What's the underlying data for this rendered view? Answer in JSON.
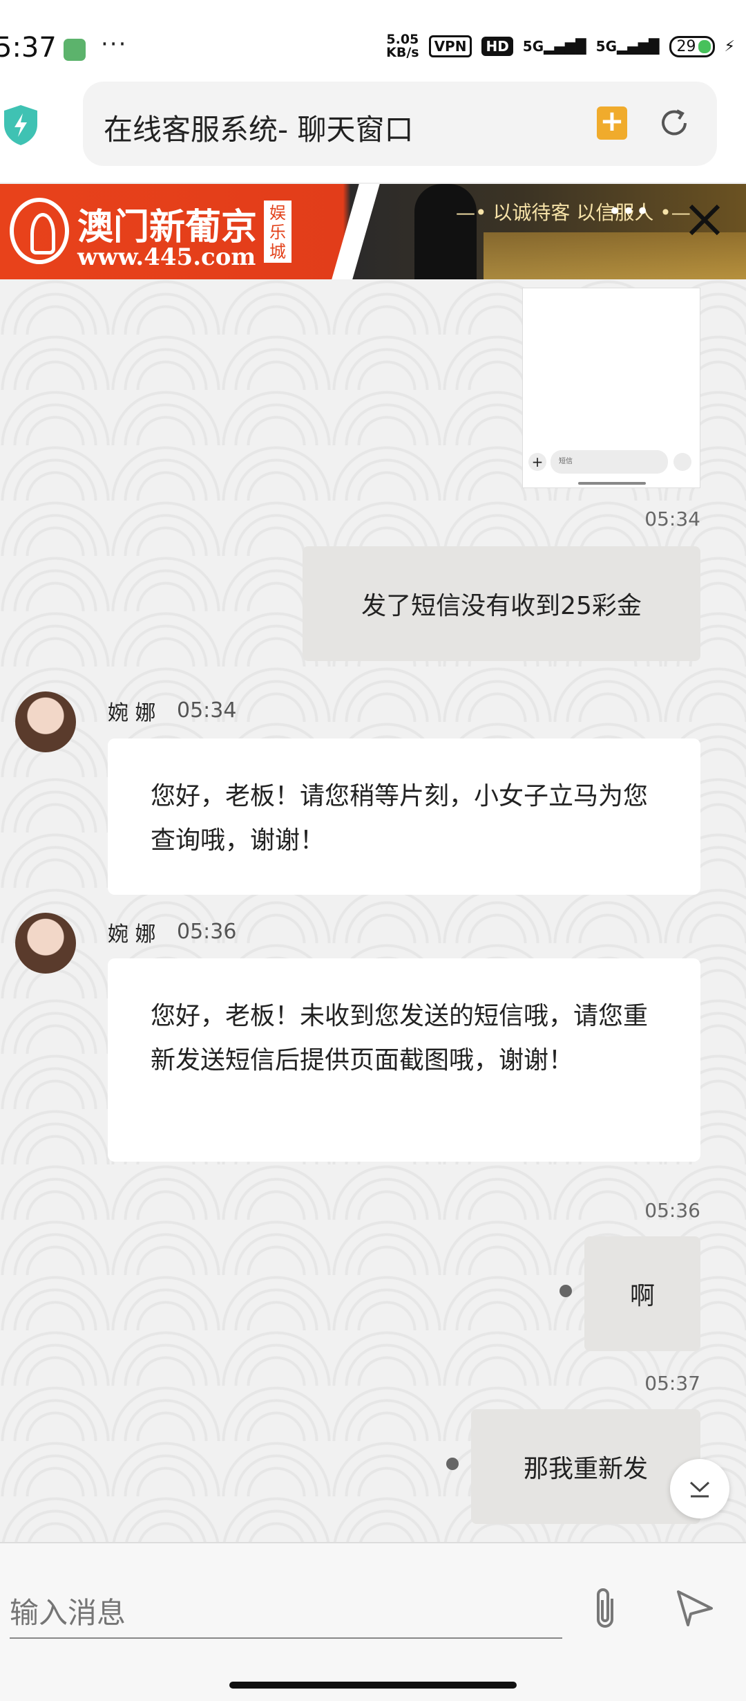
{
  "status_bar": {
    "time": "5:37",
    "more": "···",
    "net_speed_value": "5.05",
    "net_speed_unit": "KB/s",
    "vpn": "VPN",
    "hd": "HD",
    "sim1": "5G",
    "sim2": "5G",
    "battery": "29"
  },
  "browser": {
    "title": "在线客服系统- 聊天窗口",
    "icons": {
      "shield": "shield-bolt-icon",
      "bookmark": "add-bookmark-icon",
      "reload": "reload-icon"
    },
    "accent_color": "#f0ab2c"
  },
  "banner": {
    "title": "澳门新葡京",
    "url": "www.445.com",
    "tag": "娱乐城",
    "slogan": "—• 以诚待客 以信服人 •—",
    "more": "•••",
    "brand_color": "#e3421b"
  },
  "chat": {
    "image_message": {
      "input_placeholder": "短信"
    },
    "messages": [
      {
        "side": "right",
        "time": "05:34",
        "text": "发了短信没有收到25彩金"
      },
      {
        "side": "left",
        "sender": "婉 娜",
        "time": "05:34",
        "text": "您好，老板！请您稍等片刻，小女子立马为您查询哦，谢谢！"
      },
      {
        "side": "left",
        "sender": "婉 娜",
        "time": "05:36",
        "text": "您好，老板！未收到您发送的短信哦，请您重新发送短信后提供页面截图哦，谢谢！"
      },
      {
        "side": "right",
        "time": "05:36",
        "text": "啊"
      },
      {
        "side": "right",
        "time": "05:37",
        "text": "那我重新发"
      }
    ]
  },
  "composer": {
    "placeholder": "输入消息",
    "icons": {
      "attach": "paperclip-icon",
      "send": "send-icon",
      "scroll": "scroll-down-icon"
    }
  }
}
